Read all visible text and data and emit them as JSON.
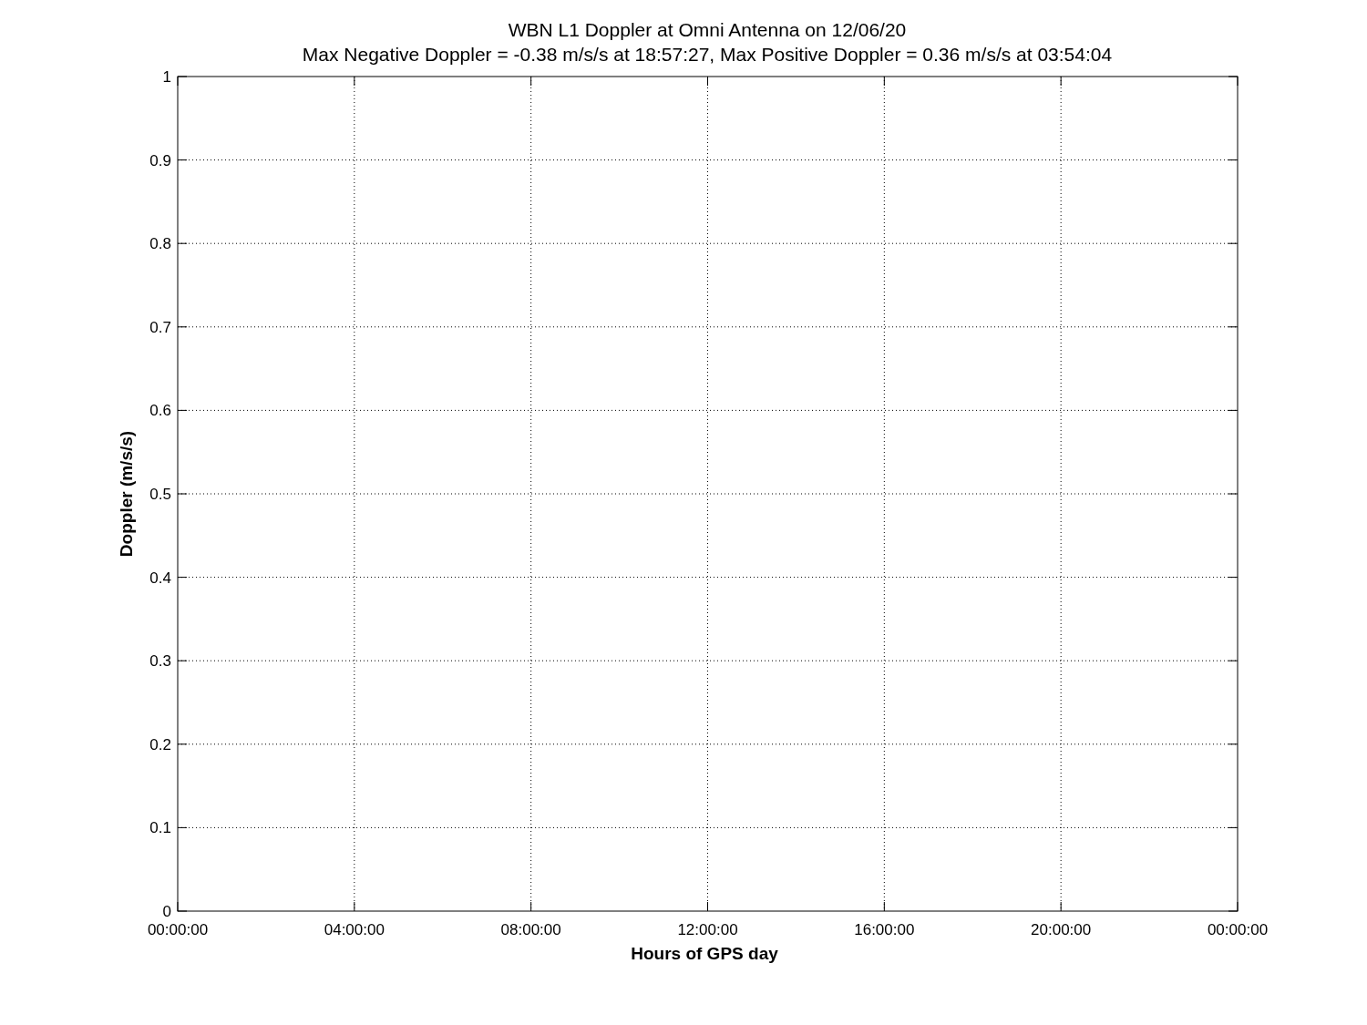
{
  "figure": {
    "subtitle": "Max Negative Doppler = -0.38 m/s/s  at 18:57:27,   Max Positive Doppler = 0.36 m/s/s  at 03:54:04",
    "chart_data": {
      "type": "line",
      "title": "WBN  L1 Doppler at Omni Antenna on 12/06/20",
      "xlabel": "Hours of GPS day",
      "ylabel": "Doppler (m/s/s)",
      "grid": true,
      "ylim": [
        0,
        1
      ],
      "categories": [
        "00:00:00",
        "04:00:00",
        "08:00:00",
        "12:00:00",
        "16:00:00",
        "20:00:00",
        "00:00:00"
      ],
      "yticks": [
        0,
        0.1,
        0.2,
        0.3,
        0.4,
        0.5,
        0.6,
        0.7,
        0.8,
        0.9,
        1
      ]
    }
  }
}
